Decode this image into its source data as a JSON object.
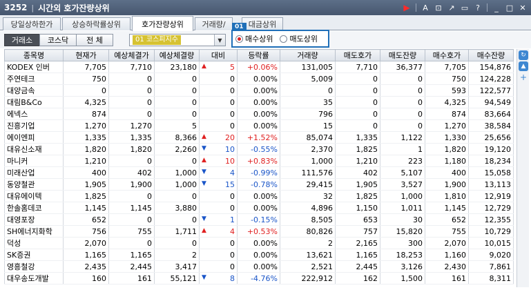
{
  "window": {
    "number": "3252",
    "title": "시간외 호가잔량상위"
  },
  "titlebar_icons": [
    "play-icon",
    "font-icon",
    "new-window-icon",
    "link-icon",
    "restore-icon",
    "help-icon",
    "minimize-icon",
    "maximize-icon",
    "close-icon"
  ],
  "tabs": [
    {
      "label": "당일상하한가"
    },
    {
      "label": "상승하락률상위"
    },
    {
      "label": "호가잔량상위"
    },
    {
      "label": "거래량/"
    },
    {
      "label": "대금상위"
    }
  ],
  "market_segments": [
    {
      "label": "거래소"
    },
    {
      "label": "코스닥"
    },
    {
      "label": "전 체"
    }
  ],
  "category_select": {
    "value": "01 코스피지수"
  },
  "radio": {
    "badge": "01",
    "options": [
      {
        "label": "매수상위",
        "selected": true
      },
      {
        "label": "매도상위",
        "selected": false
      }
    ]
  },
  "columns": [
    "종목명",
    "현재가",
    "예상체결가",
    "예상체결량",
    "대비",
    "등락률",
    "거래량",
    "매도호가",
    "매도잔량",
    "매수호가",
    "매수잔량"
  ],
  "rows": [
    {
      "name": "KODEX 인버",
      "price": "7,705",
      "exp_price": "7,710",
      "exp_vol": "23,180",
      "dir": "up",
      "diff": "5",
      "rate": "+0.06%",
      "volume": "131,005",
      "ask": "7,710",
      "ask_qty": "36,377",
      "bid": "7,705",
      "bid_qty": "154,876"
    },
    {
      "name": "주연테크",
      "price": "750",
      "exp_price": "0",
      "exp_vol": "0",
      "dir": "",
      "diff": "0",
      "rate": "0.00%",
      "volume": "5,009",
      "ask": "0",
      "ask_qty": "0",
      "bid": "750",
      "bid_qty": "124,228"
    },
    {
      "name": "대양금속",
      "price": "0",
      "exp_price": "0",
      "exp_vol": "0",
      "dir": "",
      "diff": "0",
      "rate": "0.00%",
      "volume": "0",
      "ask": "0",
      "ask_qty": "0",
      "bid": "593",
      "bid_qty": "122,577"
    },
    {
      "name": "대림B&Co",
      "price": "4,325",
      "exp_price": "0",
      "exp_vol": "0",
      "dir": "",
      "diff": "0",
      "rate": "0.00%",
      "volume": "35",
      "ask": "0",
      "ask_qty": "0",
      "bid": "4,325",
      "bid_qty": "94,549"
    },
    {
      "name": "에넥스",
      "price": "874",
      "exp_price": "0",
      "exp_vol": "0",
      "dir": "",
      "diff": "0",
      "rate": "0.00%",
      "volume": "796",
      "ask": "0",
      "ask_qty": "0",
      "bid": "874",
      "bid_qty": "83,664"
    },
    {
      "name": "진흥기업",
      "price": "1,270",
      "exp_price": "1,270",
      "exp_vol": "5",
      "dir": "",
      "diff": "0",
      "rate": "0.00%",
      "volume": "15",
      "ask": "0",
      "ask_qty": "0",
      "bid": "1,270",
      "bid_qty": "38,584"
    },
    {
      "name": "에이엔피",
      "price": "1,335",
      "exp_price": "1,335",
      "exp_vol": "8,366",
      "dir": "up",
      "diff": "20",
      "rate": "+1.52%",
      "volume": "85,074",
      "ask": "1,335",
      "ask_qty": "1,122",
      "bid": "1,330",
      "bid_qty": "25,656"
    },
    {
      "name": "대유신소재",
      "price": "1,820",
      "exp_price": "1,820",
      "exp_vol": "2,260",
      "dir": "down",
      "diff": "10",
      "rate": "-0.55%",
      "volume": "2,370",
      "ask": "1,825",
      "ask_qty": "1",
      "bid": "1,820",
      "bid_qty": "19,120"
    },
    {
      "name": "마니커",
      "price": "1,210",
      "exp_price": "0",
      "exp_vol": "0",
      "dir": "up",
      "diff": "10",
      "rate": "+0.83%",
      "volume": "1,000",
      "ask": "1,210",
      "ask_qty": "223",
      "bid": "1,180",
      "bid_qty": "18,234"
    },
    {
      "name": "미래산업",
      "price": "400",
      "exp_price": "402",
      "exp_vol": "1,000",
      "dir": "down",
      "diff": "4",
      "rate": "-0.99%",
      "volume": "111,576",
      "ask": "402",
      "ask_qty": "5,107",
      "bid": "400",
      "bid_qty": "15,058"
    },
    {
      "name": "동양철관",
      "price": "1,905",
      "exp_price": "1,900",
      "exp_vol": "1,000",
      "dir": "down",
      "diff": "15",
      "rate": "-0.78%",
      "volume": "29,415",
      "ask": "1,905",
      "ask_qty": "3,527",
      "bid": "1,900",
      "bid_qty": "13,113"
    },
    {
      "name": "대유에이텍",
      "price": "1,825",
      "exp_price": "0",
      "exp_vol": "0",
      "dir": "",
      "diff": "0",
      "rate": "0.00%",
      "volume": "32",
      "ask": "1,825",
      "ask_qty": "1,000",
      "bid": "1,810",
      "bid_qty": "12,919"
    },
    {
      "name": "한솔홈데코",
      "price": "1,145",
      "exp_price": "1,145",
      "exp_vol": "3,880",
      "dir": "",
      "diff": "0",
      "rate": "0.00%",
      "volume": "4,896",
      "ask": "1,150",
      "ask_qty": "1,011",
      "bid": "1,145",
      "bid_qty": "12,729"
    },
    {
      "name": "대영포장",
      "price": "652",
      "exp_price": "0",
      "exp_vol": "0",
      "dir": "down",
      "diff": "1",
      "rate": "-0.15%",
      "volume": "8,505",
      "ask": "653",
      "ask_qty": "30",
      "bid": "652",
      "bid_qty": "12,355"
    },
    {
      "name": "SH에너지화학",
      "price": "756",
      "exp_price": "755",
      "exp_vol": "1,711",
      "dir": "up",
      "diff": "4",
      "rate": "+0.53%",
      "volume": "80,826",
      "ask": "757",
      "ask_qty": "15,820",
      "bid": "755",
      "bid_qty": "10,729"
    },
    {
      "name": "덕성",
      "price": "2,070",
      "exp_price": "0",
      "exp_vol": "0",
      "dir": "",
      "diff": "0",
      "rate": "0.00%",
      "volume": "2",
      "ask": "2,165",
      "ask_qty": "300",
      "bid": "2,070",
      "bid_qty": "10,015"
    },
    {
      "name": "SK증권",
      "price": "1,165",
      "exp_price": "1,165",
      "exp_vol": "2",
      "dir": "",
      "diff": "0",
      "rate": "0.00%",
      "volume": "13,621",
      "ask": "1,165",
      "ask_qty": "18,253",
      "bid": "1,160",
      "bid_qty": "9,020"
    },
    {
      "name": "영흥철강",
      "price": "2,435",
      "exp_price": "2,445",
      "exp_vol": "3,417",
      "dir": "",
      "diff": "0",
      "rate": "0.00%",
      "volume": "2,521",
      "ask": "2,445",
      "ask_qty": "3,126",
      "bid": "2,430",
      "bid_qty": "7,861"
    },
    {
      "name": "대우송도개발",
      "price": "160",
      "exp_price": "161",
      "exp_vol": "55,121",
      "dir": "down",
      "diff": "8",
      "rate": "-4.76%",
      "volume": "222,912",
      "ask": "162",
      "ask_qty": "1,500",
      "bid": "161",
      "bid_qty": "8,311"
    }
  ],
  "colors": {
    "up": "#e02020",
    "down": "#1a55c8",
    "accent": "#1f6fb8"
  }
}
